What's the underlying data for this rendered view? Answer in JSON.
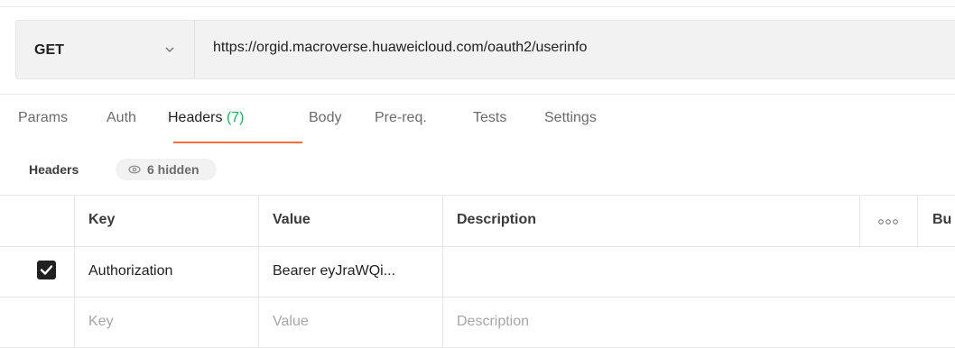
{
  "request": {
    "method": "GET",
    "url": "https://orgid.macroverse.huaweicloud.com/oauth2/userinfo"
  },
  "tabs": [
    {
      "label": "Params"
    },
    {
      "label": "Auth"
    },
    {
      "label": "Headers",
      "count": "(7)"
    },
    {
      "label": "Body"
    },
    {
      "label": "Pre-req."
    },
    {
      "label": "Tests"
    },
    {
      "label": "Settings"
    }
  ],
  "active_tab": "Headers",
  "headers_section": {
    "title": "Headers",
    "hidden_label": "6 hidden"
  },
  "table": {
    "columns": {
      "key": "Key",
      "value": "Value",
      "description": "Description",
      "bulk_edit": "Bu"
    },
    "rows": [
      {
        "checked": true,
        "key": "Authorization",
        "value": "Bearer eyJraWQi...",
        "description": ""
      }
    ],
    "placeholder": {
      "key": "Key",
      "value": "Value",
      "description": "Description"
    }
  },
  "colors": {
    "accent": "#ff6c37",
    "count": "#0cbb52",
    "checkbox": "#212121"
  },
  "icons": {
    "method_dropdown": "chevron-down-icon",
    "hidden_toggle": "eye-icon",
    "checkbox": "checkmark-icon",
    "more": "more-horizontal-icon"
  }
}
